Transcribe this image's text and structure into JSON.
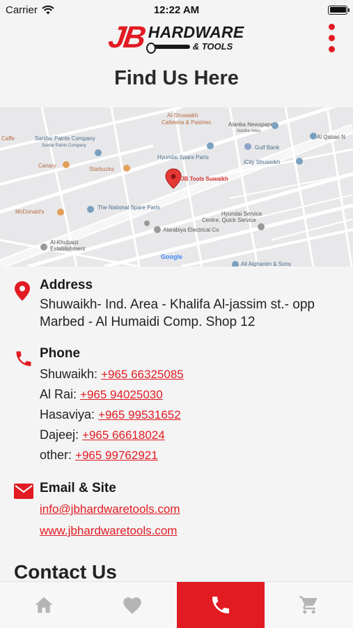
{
  "status_bar": {
    "carrier": "Carrier",
    "time": "12:22 AM"
  },
  "header": {
    "logo_jb": "JB",
    "logo_hardware": "HARDWARE",
    "logo_tools": "& TOOLS"
  },
  "page": {
    "title": "Find Us Here"
  },
  "map": {
    "pin_label": "JB Tools Suwaikh",
    "google": "Google",
    "places": [
      "Al-Shuwaikh",
      "Cafeteria & Pastries",
      "Alanba Newspaper",
      "Alanba news",
      "Al Qabas N",
      "Saridar Paints Company",
      "Sardar Paints Company",
      "Caffe",
      "Gulf Bank",
      "Hyundai Spare Parts",
      "Canary",
      "Starbucks",
      "iCity Shuweikh",
      "McDonald's",
      "The National Spare Parts",
      "Hyundai Service",
      "Centre, Quick Service",
      "Alarabiya Electrical Co",
      "Al-Khubaizi",
      "Establishment",
      "Ali Alghanim & Sons"
    ]
  },
  "address": {
    "title": "Address",
    "line1": "Shuwaikh- Ind. Area - Khalifa Al-jassim st.- opp",
    "line2": "Marbed - Al Humaidi Comp. Shop 12"
  },
  "phone": {
    "title": "Phone",
    "rows": [
      {
        "label": "Shuwaikh:",
        "number": "+965 66325085"
      },
      {
        "label": "Al Rai:",
        "number": "+965 94025030"
      },
      {
        "label": "Hasaviya:",
        "number": "+965 99531652"
      },
      {
        "label": "Dajeej:",
        "number": "+965 66618024"
      },
      {
        "label": "other:",
        "number": "+965 99762921"
      }
    ]
  },
  "email": {
    "title": "Email & Site",
    "email": "info@jbhardwaretools.com",
    "site": "www.jbhardwaretools.com"
  },
  "contact": {
    "title": "Contact Us"
  },
  "nav": {
    "items": [
      {
        "icon": "home-icon",
        "active": false
      },
      {
        "icon": "heart-icon",
        "active": false
      },
      {
        "icon": "phone-icon",
        "active": true
      },
      {
        "icon": "cart-icon",
        "active": false
      }
    ]
  },
  "colors": {
    "accent": "#e21b23",
    "text": "#1f1f1f",
    "nav_icon": "#b5b5b5"
  }
}
